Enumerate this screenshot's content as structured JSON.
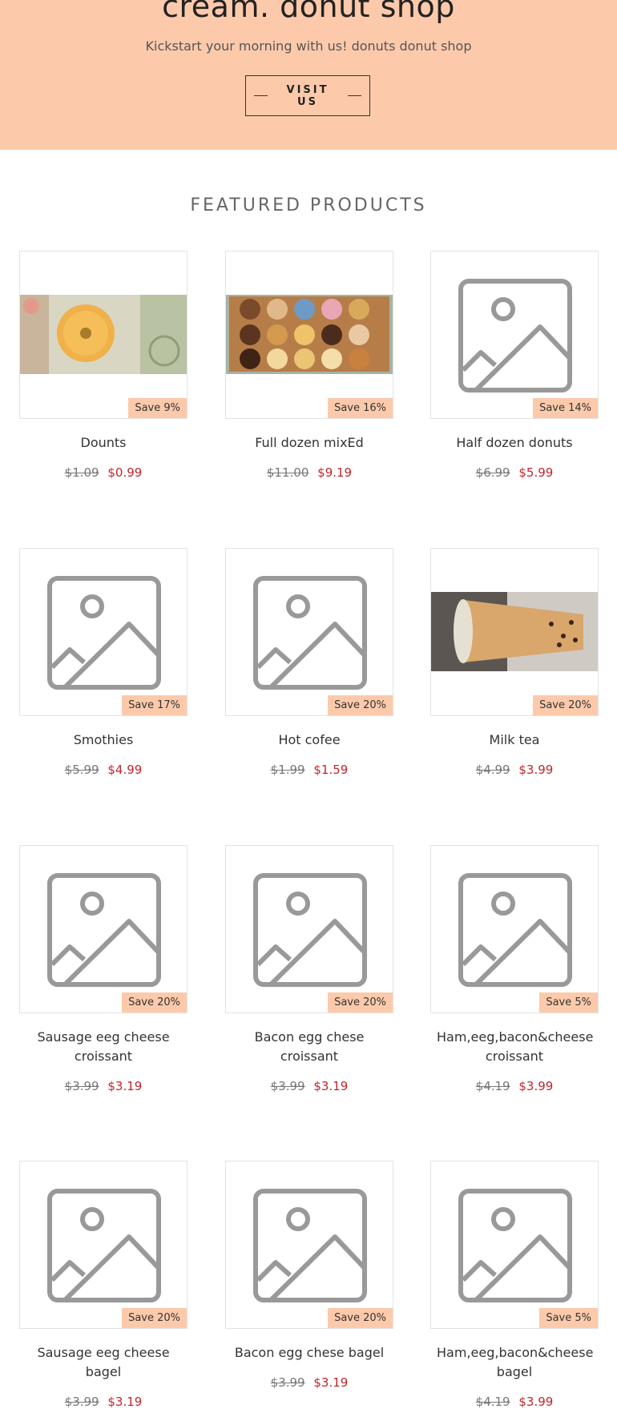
{
  "hero": {
    "title": "cream. donut shop",
    "subtitle": "Kickstart your morning with us! donuts donut shop",
    "button_label": "VISIT US"
  },
  "section_title": "FEATURED PRODUCTS",
  "colors": {
    "hero_bg": "#fccaab",
    "sale_price": "#c0262d",
    "badge_bg": "#fccaab"
  },
  "products": [
    {
      "name": "Dounts",
      "old_price": "$1.09",
      "price": "$0.99",
      "badge": "Save 9%",
      "image": "single-glazed-donut-photo"
    },
    {
      "name": "Full dozen mixEd",
      "old_price": "$11.00",
      "price": "$9.19",
      "badge": "Save 16%",
      "image": "dozen-donuts-box-photo"
    },
    {
      "name": "Half dozen donuts",
      "old_price": "$6.99",
      "price": "$5.99",
      "badge": "Save 14%",
      "image": "placeholder"
    },
    {
      "name": "Smothies",
      "old_price": "$5.99",
      "price": "$4.99",
      "badge": "Save 17%",
      "image": "placeholder"
    },
    {
      "name": "Hot cofee",
      "old_price": "$1.99",
      "price": "$1.59",
      "badge": "Save 20%",
      "image": "placeholder"
    },
    {
      "name": "Milk tea",
      "old_price": "$4.99",
      "price": "$3.99",
      "badge": "Save 20%",
      "image": "boba-milk-tea-photo"
    },
    {
      "name": "Sausage eeg cheese croissant",
      "old_price": "$3.99",
      "price": "$3.19",
      "badge": "Save 20%",
      "image": "placeholder"
    },
    {
      "name": "Bacon egg chese croissant",
      "old_price": "$3.99",
      "price": "$3.19",
      "badge": "Save 20%",
      "image": "placeholder"
    },
    {
      "name": "Ham,eeg,bacon&cheese croissant",
      "old_price": "$4.19",
      "price": "$3.99",
      "badge": "Save 5%",
      "image": "placeholder"
    },
    {
      "name": "Sausage eeg cheese bagel",
      "old_price": "$3.99",
      "price": "$3.19",
      "badge": "Save 20%",
      "image": "placeholder"
    },
    {
      "name": "Bacon egg chese bagel",
      "old_price": "$3.99",
      "price": "$3.19",
      "badge": "Save 20%",
      "image": "placeholder"
    },
    {
      "name": "Ham,eeg,bacon&cheese bagel",
      "old_price": "$4.19",
      "price": "$3.99",
      "badge": "Save 5%",
      "image": "placeholder"
    }
  ]
}
